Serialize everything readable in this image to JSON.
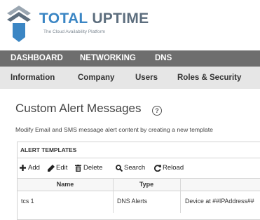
{
  "brand": {
    "name_part1": "TOTAL",
    "name_part2": "UPTIME",
    "tagline": "The Cloud Availability Platform"
  },
  "nav_primary": {
    "items": [
      {
        "label": "DASHBOARD"
      },
      {
        "label": "NETWORKING"
      },
      {
        "label": "DNS"
      }
    ]
  },
  "nav_secondary": {
    "items": [
      {
        "label": "Information"
      },
      {
        "label": "Company"
      },
      {
        "label": "Users"
      },
      {
        "label": "Roles & Security"
      }
    ]
  },
  "page": {
    "title": "Custom Alert Messages",
    "help_glyph": "?",
    "description": "Modify Email and SMS message alert content by creating a new template"
  },
  "panel": {
    "title": "ALERT TEMPLATES",
    "toolbar": {
      "add_label": "Add",
      "edit_label": "Edit",
      "delete_label": "Delete",
      "search_label": "Search",
      "reload_label": "Reload"
    },
    "table": {
      "columns": [
        "Name",
        "Type",
        ""
      ],
      "rows": [
        {
          "name": "tcs 1",
          "type": "DNS Alerts",
          "content": "Device at ##IPAddress##"
        }
      ]
    }
  },
  "colors": {
    "brand_blue": "#3b86c4",
    "brand_gray": "#5d6e7e",
    "nav_primary_bg": "#6e6e6e",
    "nav_secondary_bg": "#e6e6e6"
  },
  "icons": {
    "logo": "total-uptime-logo",
    "add": "plus-icon",
    "edit": "pencil-icon",
    "delete": "trash-icon",
    "search": "magnifier-icon",
    "reload": "refresh-icon",
    "help": "question-circle-icon"
  }
}
